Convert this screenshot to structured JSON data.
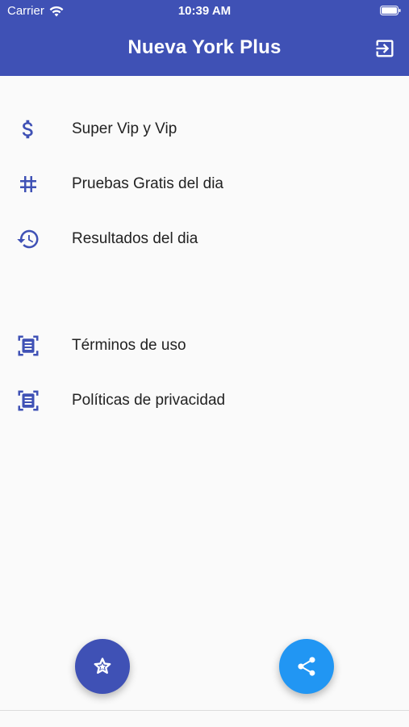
{
  "status_bar": {
    "carrier": "Carrier",
    "time": "10:39 AM"
  },
  "app_bar": {
    "title": "Nueva York Plus",
    "background": "#3f51b5",
    "action_icon": "logout-icon"
  },
  "menu": {
    "icon_color": "#3f51b5",
    "items": [
      {
        "label": "Super Vip y Vip",
        "icon": "dollar-icon"
      },
      {
        "label": "Pruebas Gratis del dia",
        "icon": "hash-icon"
      },
      {
        "label": "Resultados del dia",
        "icon": "history-icon"
      },
      {
        "label": "Términos de uso",
        "icon": "document-scan-icon"
      },
      {
        "label": "Políticas de privacidad",
        "icon": "document-scan-icon"
      }
    ]
  },
  "fabs": {
    "rate": {
      "icon": "star-icon",
      "color": "#3f51b5"
    },
    "share": {
      "icon": "share-icon",
      "color": "#2196f3"
    }
  }
}
